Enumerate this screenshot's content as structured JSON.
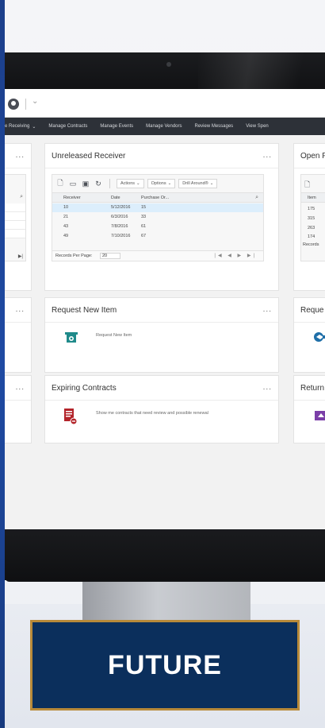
{
  "header": {
    "caret": "⌄"
  },
  "navbar": {
    "items": [
      {
        "label": "e Receiving",
        "caret": "⌄"
      },
      {
        "label": "Manage Contracts"
      },
      {
        "label": "Manage Events"
      },
      {
        "label": "Manage Vendors"
      },
      {
        "label": "Review Messages"
      },
      {
        "label": "View Spen"
      }
    ]
  },
  "cards": {
    "unreleased": {
      "title": "Unreleased Receiver",
      "more": "...",
      "toolbar": {
        "actions": "Actions",
        "options": "Options",
        "drill": "Drill Around®"
      },
      "columns": [
        "Receiver",
        "Date",
        "Purchase Or..."
      ],
      "rows": [
        [
          "10",
          "5/12/2016",
          "15"
        ],
        [
          "21",
          "6/3/2016",
          "33"
        ],
        [
          "43",
          "7/8/2016",
          "61"
        ],
        [
          "49",
          "7/10/2016",
          "67"
        ]
      ],
      "footer": {
        "label": "Records Per Page:",
        "value": "20"
      }
    },
    "open": {
      "title": "Open F",
      "columns": [
        "Item"
      ],
      "rows": [
        "175",
        "315",
        "263",
        "174"
      ],
      "footer": "Records"
    },
    "left_top": {
      "more": "..."
    },
    "left_mid": {
      "more": "..."
    },
    "left_bot": {
      "more": "..."
    },
    "request_new": {
      "title": "Request New Item",
      "more": "...",
      "task": "Request New Item"
    },
    "request_right": {
      "title": "Reque"
    },
    "expiring": {
      "title": "Expiring Contracts",
      "more": "...",
      "task": "Show me contracts that need review and possible renewal"
    },
    "return_right": {
      "title": "Return"
    }
  },
  "banner": {
    "text": "FUTURE"
  },
  "colors": {
    "navbar": "#2d3138",
    "banner_bg": "#0b2f5c",
    "banner_border": "#b88a3a",
    "teal_icon": "#1f8a8a",
    "red_icon": "#b3242a",
    "purple_icon": "#7b3fa8"
  }
}
